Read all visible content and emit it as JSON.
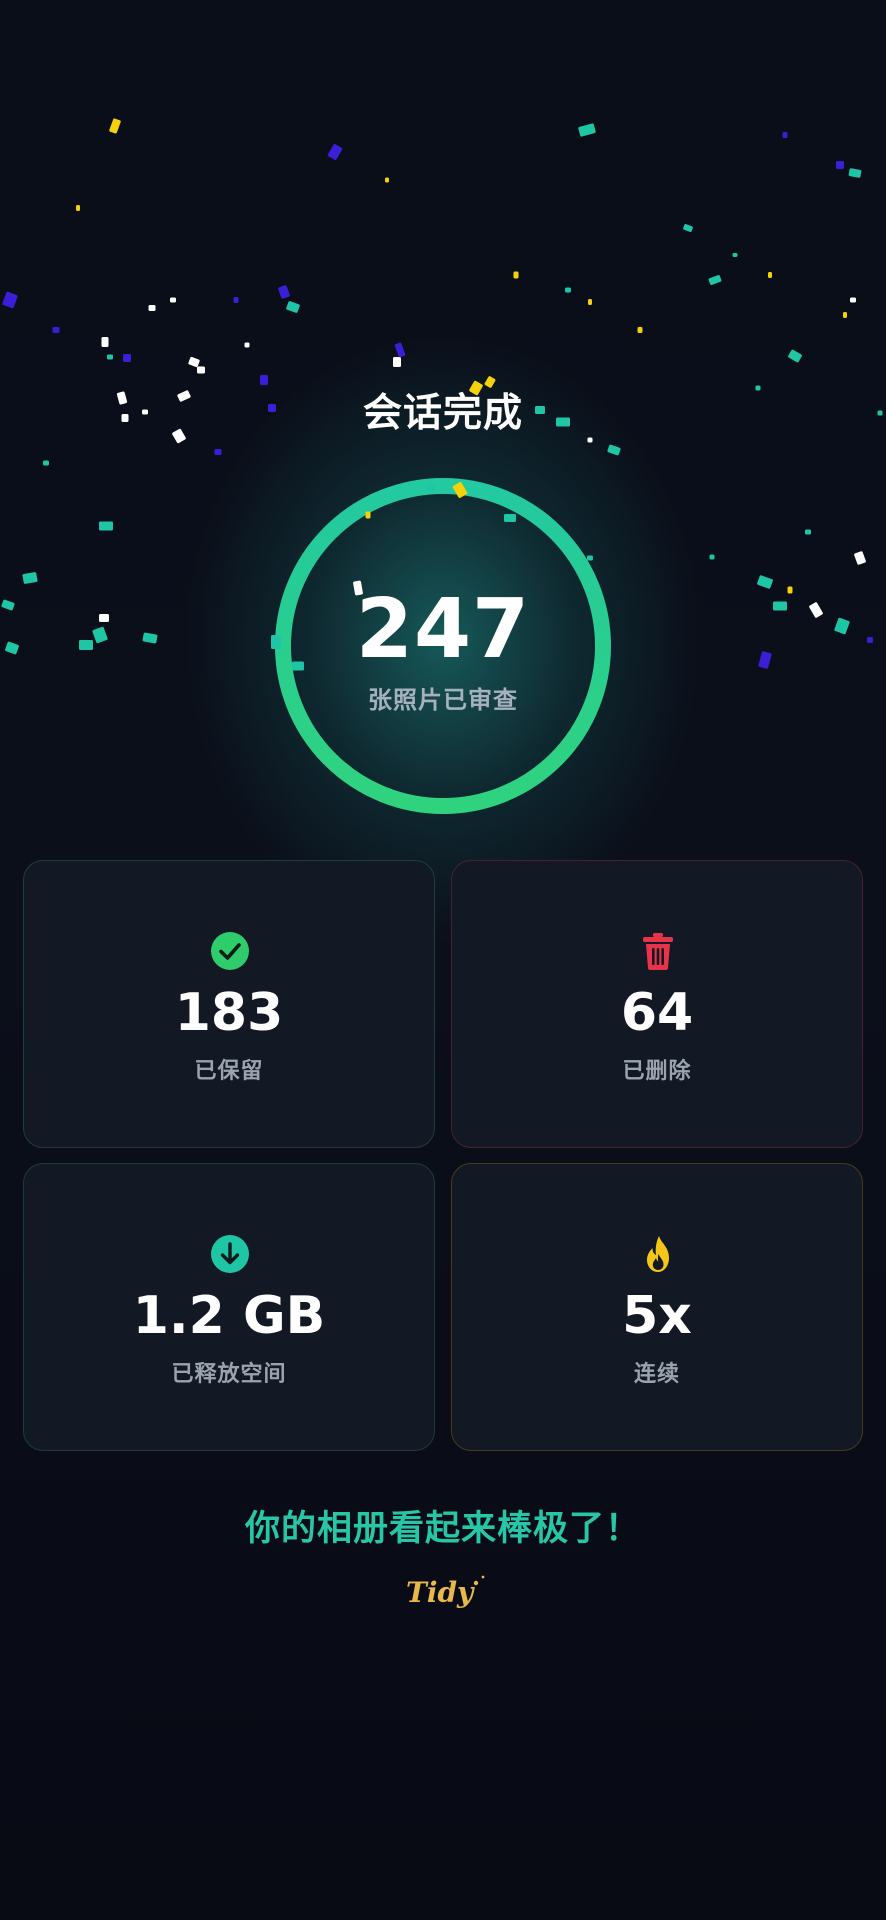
{
  "session": {
    "title": "会话完成",
    "reviewed_count": "247",
    "reviewed_label": "张照片已审查"
  },
  "stats": {
    "kept": {
      "value": "183",
      "label": "已保留",
      "icon": "check-circle-icon",
      "color": "#2ecc6b"
    },
    "deleted": {
      "value": "64",
      "label": "已删除",
      "icon": "trash-icon",
      "color": "#e8344a"
    },
    "freed": {
      "value": "1.2 GB",
      "label": "已释放空间",
      "icon": "download-icon",
      "color": "#1ec6a6"
    },
    "streak": {
      "value": "5x",
      "label": "连续",
      "icon": "flame-icon",
      "color": "#f5c518"
    }
  },
  "message": "你的相册看起来棒极了！",
  "logo": {
    "text": "Tidy",
    "color": "#e8b84a"
  },
  "colors": {
    "background": "#0a0d17",
    "ring_start": "#2ed089",
    "ring_end": "#1fc6a5",
    "accent": "#27c6a7"
  }
}
